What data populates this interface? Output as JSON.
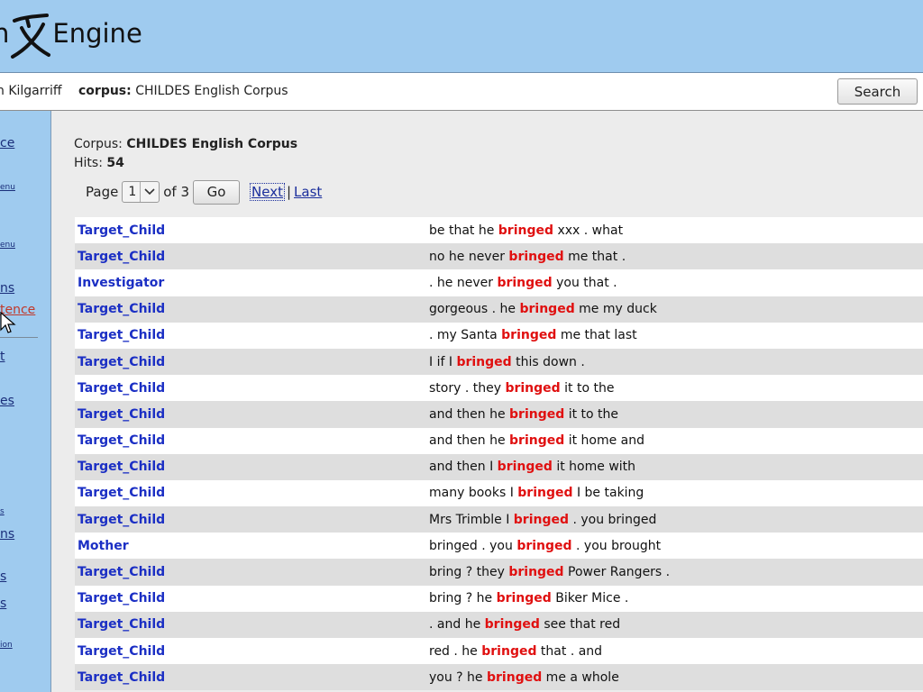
{
  "header": {
    "logo_prefix": "n",
    "logo_suffix": "Engine"
  },
  "toolbar": {
    "user": "n Kilgarriff",
    "corpus_label": "corpus:",
    "corpus_name": "CHILDES English Corpus",
    "search_label": "Search"
  },
  "sidebar": {
    "items": [
      "ce",
      "enu",
      "enu",
      "ns",
      "tence",
      "t",
      "es",
      "s",
      "ns",
      "s",
      "s",
      "ion"
    ]
  },
  "main": {
    "corpus_prefix": "Corpus:",
    "corpus_name": "CHILDES English Corpus",
    "hits_prefix": "Hits:",
    "hits": "54",
    "page_label": "Page",
    "page_value": "1",
    "page_of": "of 3",
    "go_label": "Go",
    "next_label": "Next",
    "separator": "|",
    "last_label": "Last"
  },
  "results": [
    {
      "speaker": "Target_Child",
      "left": "be that he ",
      "kw": "bringed",
      "right": " xxx . what"
    },
    {
      "speaker": "Target_Child",
      "left": "no he never ",
      "kw": "bringed",
      "right": " me that ."
    },
    {
      "speaker": "Investigator",
      "left": ". he never ",
      "kw": "bringed",
      "right": " you that ."
    },
    {
      "speaker": "Target_Child",
      "left": "gorgeous . he ",
      "kw": "bringed",
      "right": " me my duck"
    },
    {
      "speaker": "Target_Child",
      "left": ". my Santa ",
      "kw": "bringed",
      "right": " me that last"
    },
    {
      "speaker": "Target_Child",
      "left": "I if I ",
      "kw": "bringed",
      "right": " this down ."
    },
    {
      "speaker": "Target_Child",
      "left": "story . they ",
      "kw": "bringed",
      "right": " it to the"
    },
    {
      "speaker": "Target_Child",
      "left": "and then he ",
      "kw": "bringed",
      "right": " it to the"
    },
    {
      "speaker": "Target_Child",
      "left": "and then he ",
      "kw": "bringed",
      "right": " it home and"
    },
    {
      "speaker": "Target_Child",
      "left": "and then I ",
      "kw": "bringed",
      "right": " it home with"
    },
    {
      "speaker": "Target_Child",
      "left": "many books I ",
      "kw": "bringed",
      "right": " I be taking"
    },
    {
      "speaker": "Target_Child",
      "left": "Mrs Trimble I ",
      "kw": "bringed",
      "right": " . you bringed"
    },
    {
      "speaker": "Mother",
      "left": "bringed . you ",
      "kw": "bringed",
      "right": " . you brought"
    },
    {
      "speaker": "Target_Child",
      "left": "bring ? they ",
      "kw": "bringed",
      "right": " Power Rangers ."
    },
    {
      "speaker": "Target_Child",
      "left": "bring ? he ",
      "kw": "bringed",
      "right": " Biker Mice ."
    },
    {
      "speaker": "Target_Child",
      "left": ". and he ",
      "kw": "bringed",
      "right": " see that red"
    },
    {
      "speaker": "Target_Child",
      "left": "red . he ",
      "kw": "bringed",
      "right": " that . and"
    },
    {
      "speaker": "Target_Child",
      "left": "you ? he ",
      "kw": "bringed",
      "right": " me a whole"
    }
  ],
  "colors": {
    "header_bg": "#9fcbef",
    "speaker": "#1b2fc4",
    "keyword": "#e01010",
    "row_alt": "#dedede"
  }
}
